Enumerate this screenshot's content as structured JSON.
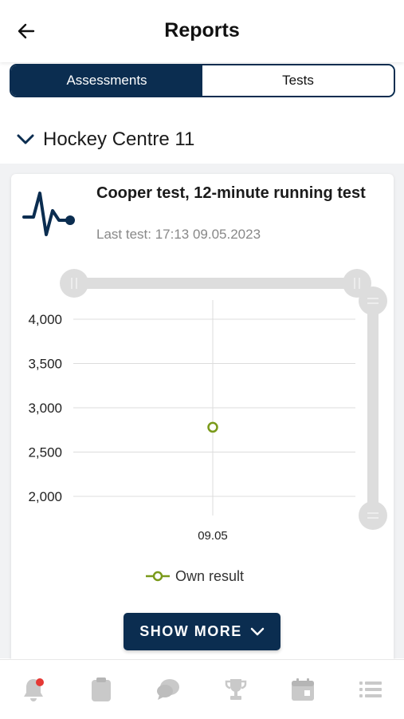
{
  "header": {
    "title": "Reports",
    "back_icon": "arrow-left-icon"
  },
  "tabs": [
    {
      "label": "Assessments",
      "active": true
    },
    {
      "label": "Tests",
      "active": false
    }
  ],
  "group": {
    "label": "Hockey Centre 11",
    "expanded": true
  },
  "report": {
    "test_name": "Cooper test, 12-minute running test",
    "last_test": "Last test: 17:13 09.05.2023",
    "icon": "heartbeat-icon",
    "show_more_label": "SHOW MORE"
  },
  "chart_data": {
    "type": "line",
    "x": [
      "09.05"
    ],
    "series": [
      {
        "name": "Own result",
        "values": [
          2780
        ]
      }
    ],
    "yticks": [
      "4,000",
      "3,500",
      "3,000",
      "2,500",
      "2,000"
    ],
    "ytick_values": [
      4000,
      3500,
      3000,
      2500,
      2000
    ],
    "ylim": [
      2000,
      4000
    ],
    "grid": true,
    "legend": "bottom",
    "colors": {
      "series": "#7a9a1a",
      "grid": "#dcdcdc",
      "slider": "#dddddd"
    }
  },
  "nav": [
    {
      "icon": "bell-icon",
      "has_badge": true
    },
    {
      "icon": "clipboard-icon"
    },
    {
      "icon": "chat-icon"
    },
    {
      "icon": "trophy-icon"
    },
    {
      "icon": "calendar-icon"
    },
    {
      "icon": "list-icon"
    }
  ],
  "colors": {
    "primary": "#0b2d50",
    "badge": "#e53935",
    "muted_icon": "#c9c9c9"
  }
}
